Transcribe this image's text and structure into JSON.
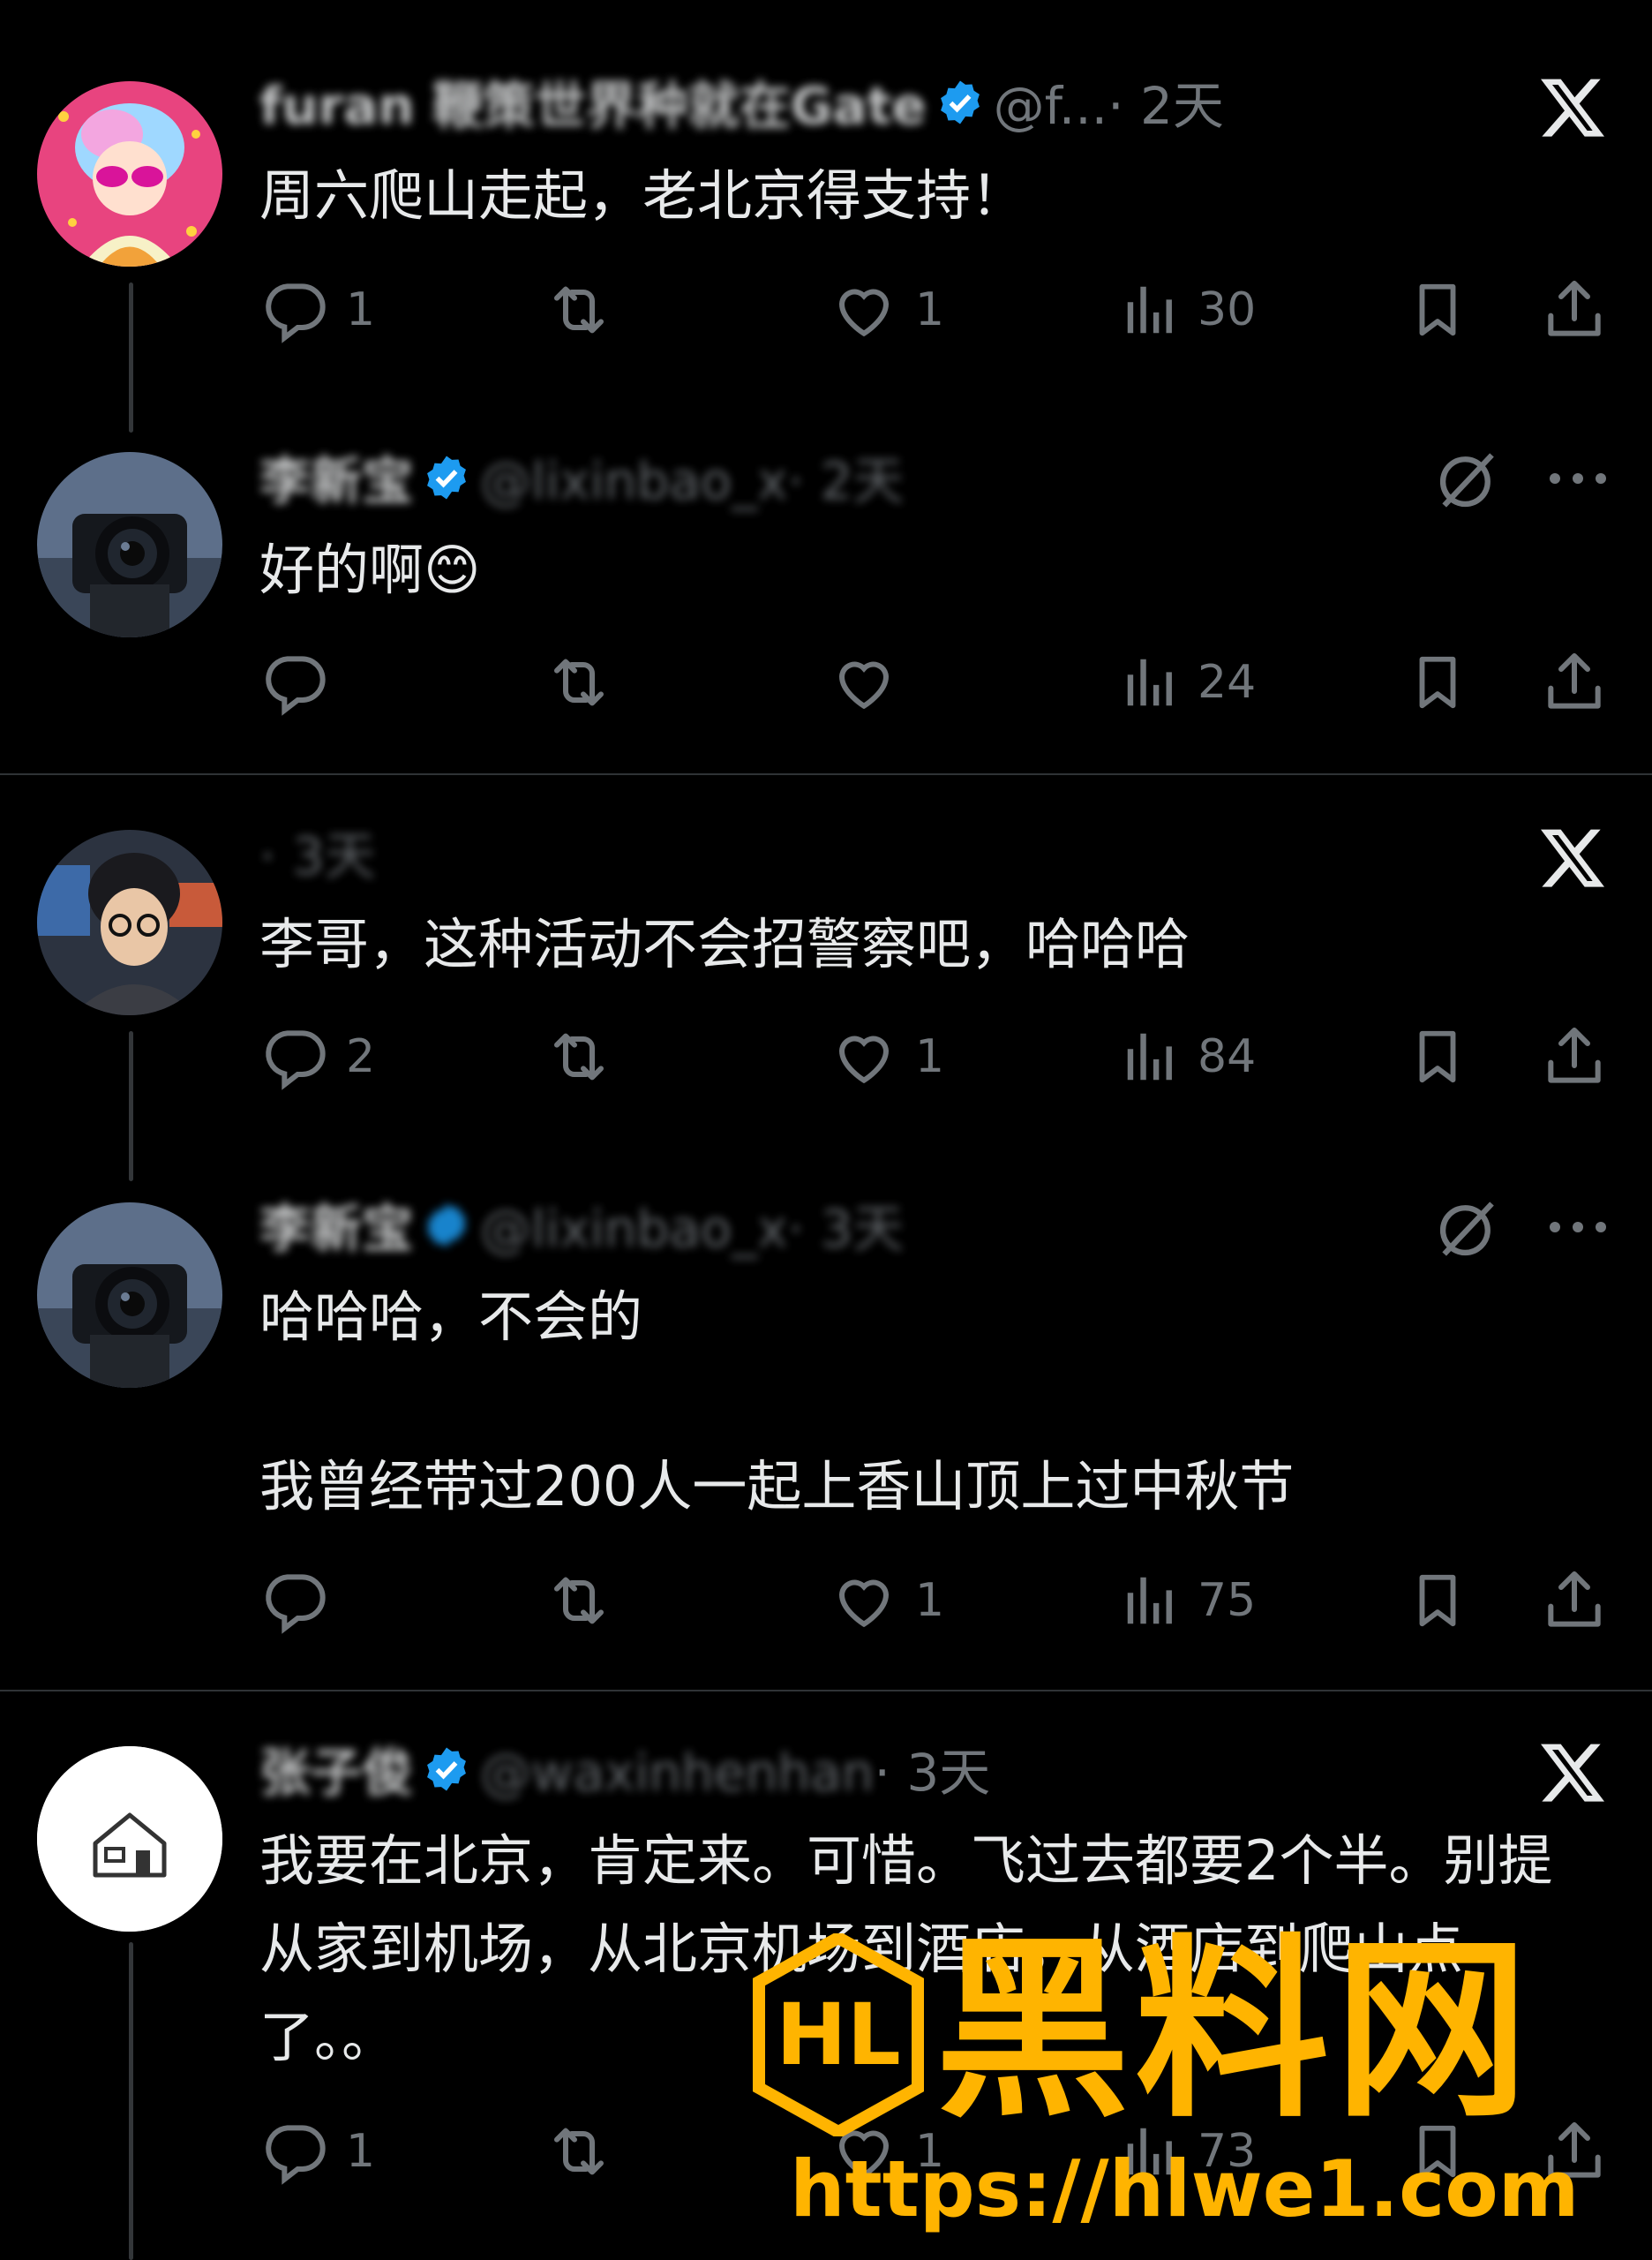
{
  "colors": {
    "background": "#000000",
    "text": "#e7e9ea",
    "muted": "#71767b",
    "verified": "#1d9bf0",
    "watermark": "#ffb400"
  },
  "posts": [
    {
      "name": "furan 鞭策世界种就在Gate",
      "handle": "@f...",
      "time": "· 2天",
      "text": "周六爬山走起，老北京得支持！",
      "reply_count": "1",
      "like_count": "1",
      "view_count": "30",
      "top_right_icon": "x-logo-icon"
    },
    {
      "name": "李新宝",
      "handle": "@lixinbao_x",
      "time": "· 2天",
      "text": "好的啊😊",
      "reply_count": "",
      "like_count": "",
      "view_count": "24",
      "top_right_icon": "grok-icon"
    },
    {
      "name": "",
      "handle": "",
      "time": "· 3天",
      "text": "李哥，这种活动不会招警察吧，哈哈哈",
      "reply_count": "2",
      "like_count": "1",
      "view_count": "84",
      "top_right_icon": "x-logo-icon"
    },
    {
      "name": "李新宝",
      "handle": "@lixinbao_x",
      "time": "· 3天",
      "text": "哈哈哈，不会的\n\n我曾经带过200人一起上香山顶上过中秋节",
      "reply_count": "",
      "like_count": "1",
      "view_count": "75",
      "top_right_icon": "grok-icon"
    },
    {
      "name": "张子俊",
      "handle": "@waxinhenhan",
      "time": "· 3天",
      "text": "我要在北京，肯定来。可惜。飞过去都要2个半。别提从家到机场，从北京机场到酒店，从酒店到爬山点了。。",
      "reply_count": "1",
      "like_count": "1",
      "view_count": "73",
      "top_right_icon": "x-logo-icon"
    }
  ],
  "watermark": {
    "title": "黑料网",
    "url": "https://hlwe1.com",
    "logo_letters": "HL"
  }
}
